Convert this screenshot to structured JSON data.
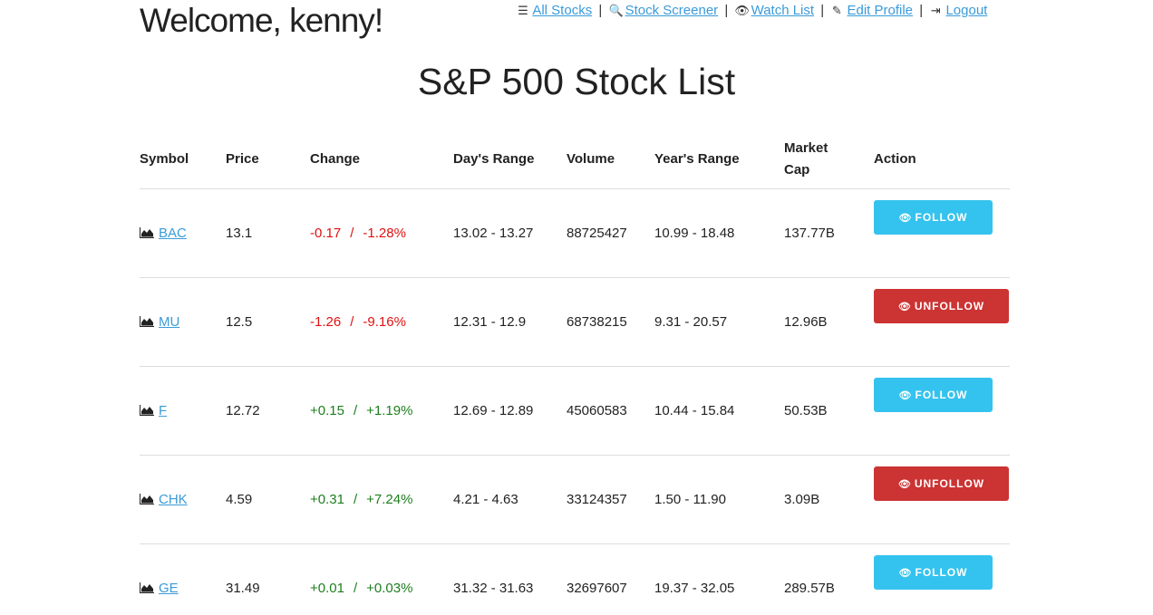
{
  "header": {
    "welcome": "Welcome, kenny!"
  },
  "nav": {
    "items": [
      {
        "label": "All Stocks",
        "icon": "list-icon",
        "glyph": "☰"
      },
      {
        "label": "Stock Screener",
        "icon": "search-icon",
        "glyph": "🔍"
      },
      {
        "label": "Watch List",
        "icon": "eye-icon",
        "glyph": "👁"
      },
      {
        "label": "Edit Profile",
        "icon": "edit-icon",
        "glyph": "✎"
      },
      {
        "label": "Logout",
        "icon": "logout-icon",
        "glyph": "⇥"
      }
    ],
    "separator": "|"
  },
  "page_title": "S&P 500 Stock List",
  "table": {
    "headers": {
      "symbol": "Symbol",
      "price": "Price",
      "change": "Change",
      "days_range": "Day's Range",
      "volume": "Volume",
      "years_range": "Year's Range",
      "market_cap_line1": "Market",
      "market_cap_line2": "Cap",
      "action": "Action"
    },
    "rows": [
      {
        "symbol": "BAC",
        "price": "13.1",
        "change": "-0.17",
        "change_pct": "-1.28%",
        "direction": "neg",
        "days_range": "13.02 - 13.27",
        "volume": "88725427",
        "years_range": "10.99 - 18.48",
        "market_cap": "137.77B",
        "action": "FOLLOW",
        "action_type": "follow"
      },
      {
        "symbol": "MU",
        "price": "12.5",
        "change": "-1.26",
        "change_pct": "-9.16%",
        "direction": "neg",
        "days_range": "12.31 - 12.9",
        "volume": "68738215",
        "years_range": "9.31 - 20.57",
        "market_cap": "12.96B",
        "action": "UNFOLLOW",
        "action_type": "unfollow"
      },
      {
        "symbol": "F",
        "price": "12.72",
        "change": "+0.15",
        "change_pct": "+1.19%",
        "direction": "pos",
        "days_range": "12.69 - 12.89",
        "volume": "45060583",
        "years_range": "10.44 - 15.84",
        "market_cap": "50.53B",
        "action": "FOLLOW",
        "action_type": "follow"
      },
      {
        "symbol": "CHK",
        "price": "4.59",
        "change": "+0.31",
        "change_pct": "+7.24%",
        "direction": "pos",
        "days_range": "4.21 - 4.63",
        "volume": "33124357",
        "years_range": "1.50 - 11.90",
        "market_cap": "3.09B",
        "action": "UNFOLLOW",
        "action_type": "unfollow"
      },
      {
        "symbol": "GE",
        "price": "31.49",
        "change": "+0.01",
        "change_pct": "+0.03%",
        "direction": "pos",
        "days_range": "31.32 - 31.63",
        "volume": "32697607",
        "years_range": "19.37 - 32.05",
        "market_cap": "289.57B",
        "action": "FOLLOW",
        "action_type": "follow"
      }
    ]
  },
  "colors": {
    "link": "#3a9bd9",
    "negative": "#e01010",
    "positive": "#1e7e1e",
    "follow_button": "#34c3ee",
    "unfollow_button": "#cc3333"
  }
}
